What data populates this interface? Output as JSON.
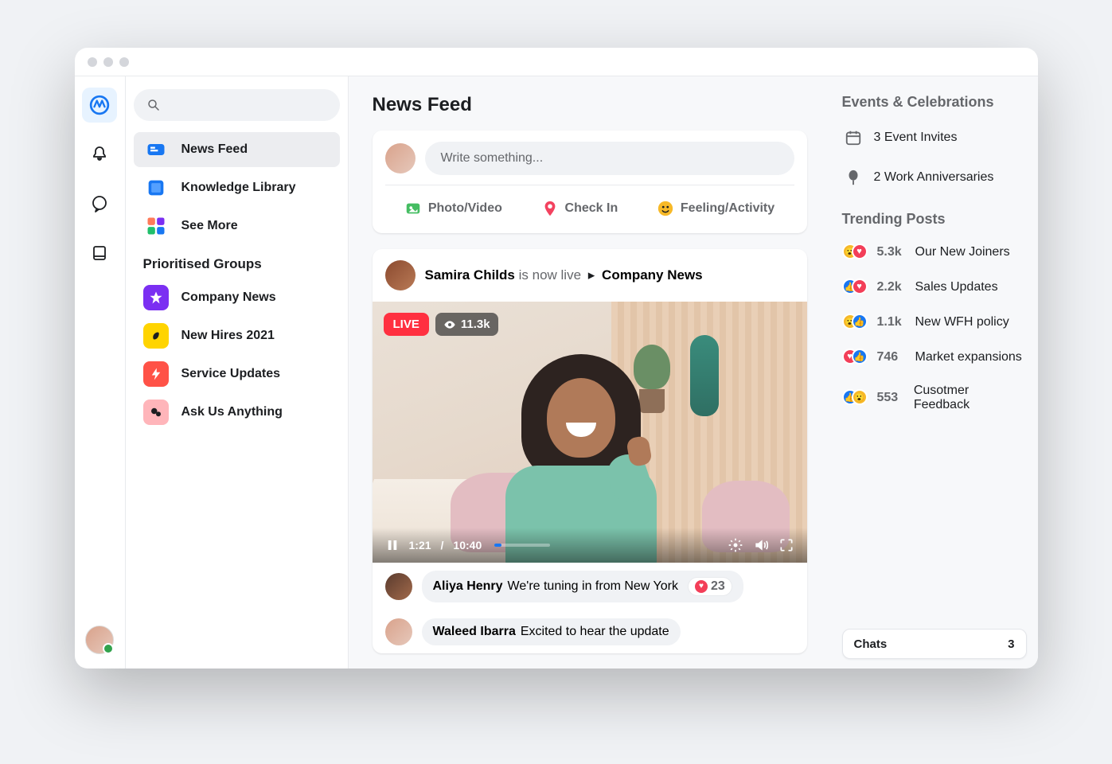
{
  "page": {
    "title": "News Feed"
  },
  "rail": {
    "items": [
      "app-logo",
      "notifications",
      "messages",
      "library"
    ]
  },
  "search": {
    "placeholder": ""
  },
  "sidebar": {
    "nav": [
      {
        "label": "News Feed",
        "icon": "news-feed"
      },
      {
        "label": "Knowledge Library",
        "icon": "knowledge-library"
      },
      {
        "label": "See More",
        "icon": "see-more"
      }
    ],
    "groups_title": "Prioritised Groups",
    "groups": [
      {
        "label": "Company News",
        "icon": "star"
      },
      {
        "label": "New Hires 2021",
        "icon": "wave"
      },
      {
        "label": "Service Updates",
        "icon": "bolt"
      },
      {
        "label": "Ask Us Anything",
        "icon": "chat-bubbles"
      }
    ]
  },
  "composer": {
    "placeholder": "Write something...",
    "actions": [
      {
        "label": "Photo/Video",
        "icon": "photo-video",
        "color": "#45bd62"
      },
      {
        "label": "Check In",
        "icon": "check-in",
        "color": "#f3425f"
      },
      {
        "label": "Feeling/Activity",
        "icon": "feeling",
        "color": "#f7b928"
      }
    ]
  },
  "post": {
    "author": "Samira Childs",
    "status": "is now live",
    "destination": "Company News",
    "live_label": "LIVE",
    "viewers": "11.3k",
    "time_current": "1:21",
    "time_total": "10:40",
    "comments": [
      {
        "name": "Aliya Henry",
        "text": "We're tuning in from New York",
        "reaction_count": "23"
      },
      {
        "name": "Waleed Ibarra",
        "text": "Excited to hear the update"
      }
    ]
  },
  "right": {
    "events_title": "Events & Celebrations",
    "events": [
      {
        "label": "3 Event Invites",
        "icon": "calendar"
      },
      {
        "label": "2 Work Anniversaries",
        "icon": "balloon"
      }
    ],
    "trending_title": "Trending Posts",
    "trending": [
      {
        "count": "5.3k",
        "label": "Our New Joiners",
        "reactions": [
          "wow",
          "love"
        ]
      },
      {
        "count": "2.2k",
        "label": "Sales Updates",
        "reactions": [
          "like",
          "love"
        ]
      },
      {
        "count": "1.1k",
        "label": "New WFH policy",
        "reactions": [
          "wow",
          "like"
        ]
      },
      {
        "count": "746",
        "label": "Market expansions",
        "reactions": [
          "love",
          "like"
        ]
      },
      {
        "count": "553",
        "label": "Cusotmer Feedback",
        "reactions": [
          "like",
          "wow"
        ]
      }
    ]
  },
  "chats": {
    "label": "Chats",
    "count": "3"
  }
}
